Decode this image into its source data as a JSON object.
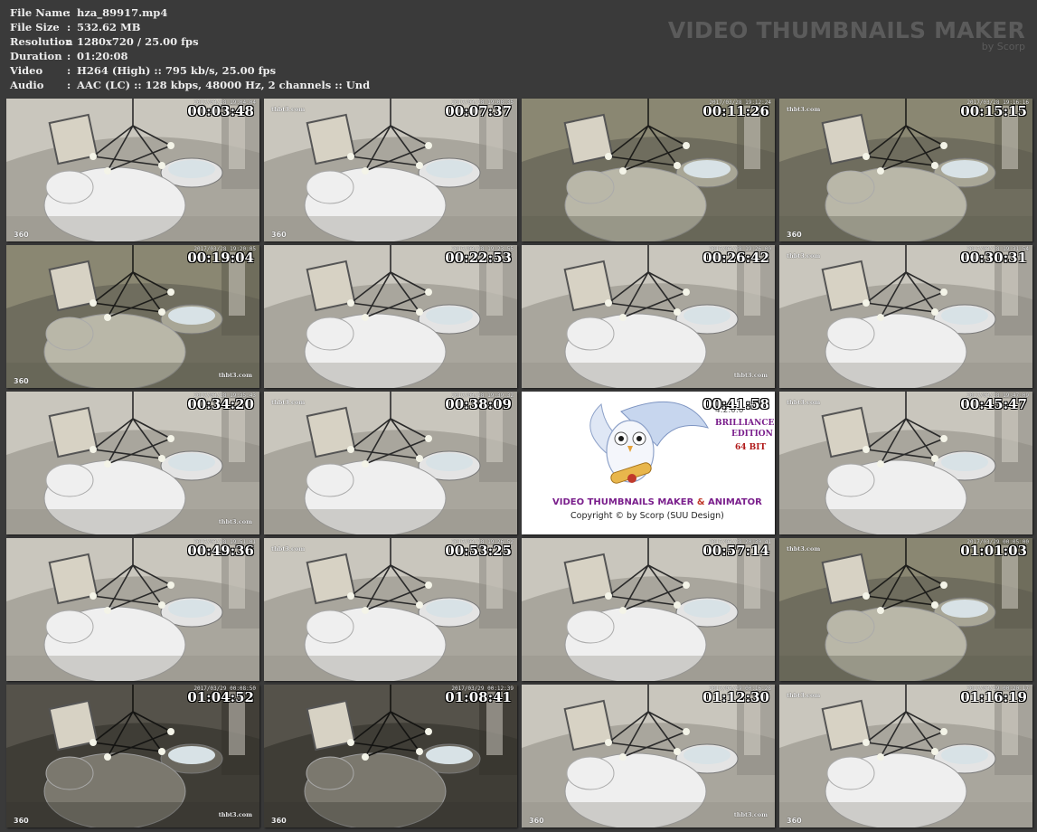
{
  "file_info": [
    {
      "label": "File Name",
      "value": "hza_89917.mp4"
    },
    {
      "label": "File Size",
      "value": "532.62 MB"
    },
    {
      "label": "Resolution",
      "value": "1280x720 / 25.00 fps"
    },
    {
      "label": "Duration",
      "value": "01:20:08"
    },
    {
      "label": "Video",
      "value": "H264 (High) :: 795 kb/s, 25.00 fps"
    },
    {
      "label": "Audio",
      "value": "AAC (LC) :: 128 kbps, 48000 Hz, 2 channels :: Und"
    }
  ],
  "separator": ":",
  "brand": {
    "title": "VIDEO THUMBNAILS MAKER",
    "subtitle": "by Scorp"
  },
  "thumbnails": [
    {
      "time": "00:03:48",
      "cam_date": "2017/03/28 19:04:04",
      "logo": "360",
      "watermark": "",
      "lighting": "bright"
    },
    {
      "time": "00:07:37",
      "cam_date": "2017/03/28 19:08:35",
      "logo": "360",
      "watermark": "thbt3.com",
      "lighting": "bright"
    },
    {
      "time": "00:11:26",
      "cam_date": "2017/03/28 19:12:24",
      "logo": "",
      "watermark": "",
      "lighting": "dim"
    },
    {
      "time": "00:15:15",
      "cam_date": "2017/03/28 19:16:16",
      "logo": "360",
      "watermark": "thbt3.com",
      "lighting": "dim"
    },
    {
      "time": "00:19:04",
      "cam_date": "2017/03/28 19:20:05",
      "logo": "360",
      "watermark": "thbt3.com",
      "lighting": "dim"
    },
    {
      "time": "00:22:53",
      "cam_date": "2017/03/28 19:23:55",
      "logo": "",
      "watermark": "",
      "lighting": "bright"
    },
    {
      "time": "00:26:42",
      "cam_date": "2017/03/28 19:26:00",
      "logo": "",
      "watermark": "thbt3.com",
      "lighting": "bright"
    },
    {
      "time": "00:30:31",
      "cam_date": "2017/03/28 19:31:54",
      "logo": "",
      "watermark": "thbt3.com",
      "lighting": "bright"
    },
    {
      "time": "00:34:20",
      "cam_date": "2017/03/28 19:35:43",
      "logo": "",
      "watermark": "thbt3.com",
      "lighting": "bright"
    },
    {
      "time": "00:38:09",
      "cam_date": "2017/03/28 19:39:32",
      "logo": "",
      "watermark": "thbt3.com",
      "lighting": "bright"
    },
    {
      "time": "00:41:58",
      "cam_date": "",
      "logo": "",
      "watermark": "",
      "lighting": "logo"
    },
    {
      "time": "00:45:47",
      "cam_date": "2017/03/28 19:47:09",
      "logo": "",
      "watermark": "thbt3.com",
      "lighting": "bright"
    },
    {
      "time": "00:49:36",
      "cam_date": "2017/03/28 19:51:01",
      "logo": "",
      "watermark": "",
      "lighting": "bright"
    },
    {
      "time": "00:53:25",
      "cam_date": "2017/03/28 19:26:52",
      "logo": "",
      "watermark": "thbt3.com",
      "lighting": "bright"
    },
    {
      "time": "00:57:14",
      "cam_date": "2017/03/28 20:30:41",
      "logo": "",
      "watermark": "",
      "lighting": "bright"
    },
    {
      "time": "01:01:03",
      "cam_date": "2017/03/29 00:05:00",
      "logo": "",
      "watermark": "thbt3.com",
      "lighting": "dim"
    },
    {
      "time": "01:04:52",
      "cam_date": "2017/03/29 00:08:50",
      "logo": "360",
      "watermark": "thbt3.com",
      "lighting": "dark"
    },
    {
      "time": "01:08:41",
      "cam_date": "2017/03/29 00:12:39",
      "logo": "360",
      "watermark": "",
      "lighting": "dark"
    },
    {
      "time": "01:12:30",
      "cam_date": "2017/03/29 00:16:28",
      "logo": "360",
      "watermark": "thbt3.com",
      "lighting": "bright"
    },
    {
      "time": "01:16:19",
      "cam_date": "2017/03/29 00:20:17",
      "logo": "360",
      "watermark": "thbt3.com",
      "lighting": "bright"
    }
  ],
  "logo_tile": {
    "version": "4.2.0.0",
    "edition_line1": "BRILLIANCE",
    "edition_line2": "EDITION",
    "edition_line3": "64 BIT",
    "title_part1": "VIDEO THUMBNAILS MAKER",
    "title_and": "&",
    "title_part2": "ANIMATOR",
    "copyright": "Copyright © by Scorp (SUU Design)"
  },
  "colors": {
    "background": "#3a3a3a",
    "info_text": "#ececec",
    "brand_text": "#5b5b5b",
    "timestamp": "#ffffff"
  }
}
